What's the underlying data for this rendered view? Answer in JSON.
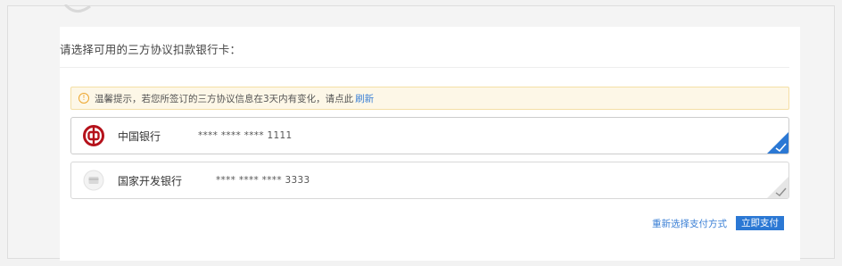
{
  "page": {
    "title": "请选择可用的三方协议扣款银行卡：",
    "notice": {
      "icon": "info-circle-icon",
      "text": "温馨提示，若您所签订的三方协议信息在3天内有变化，请点此",
      "link_label": "刷新"
    },
    "cards": [
      {
        "bank_name": "中国银行",
        "card_number": "**** **** **** 1111",
        "icon": "bank-of-china-logo-icon",
        "selected": true
      },
      {
        "bank_name": "国家开发银行",
        "card_number": "**** **** **** 3333",
        "icon": "bank-card-icon",
        "selected": false
      }
    ],
    "actions": {
      "reselect_label": "重新选择支付方式",
      "pay_label": "立即支付"
    }
  },
  "colors": {
    "accent": "#2b78d4",
    "link": "#3a7fd5",
    "notice_bg": "#fdf7e7",
    "notice_border": "#f4dfa5",
    "boc_red": "#b5121b"
  }
}
